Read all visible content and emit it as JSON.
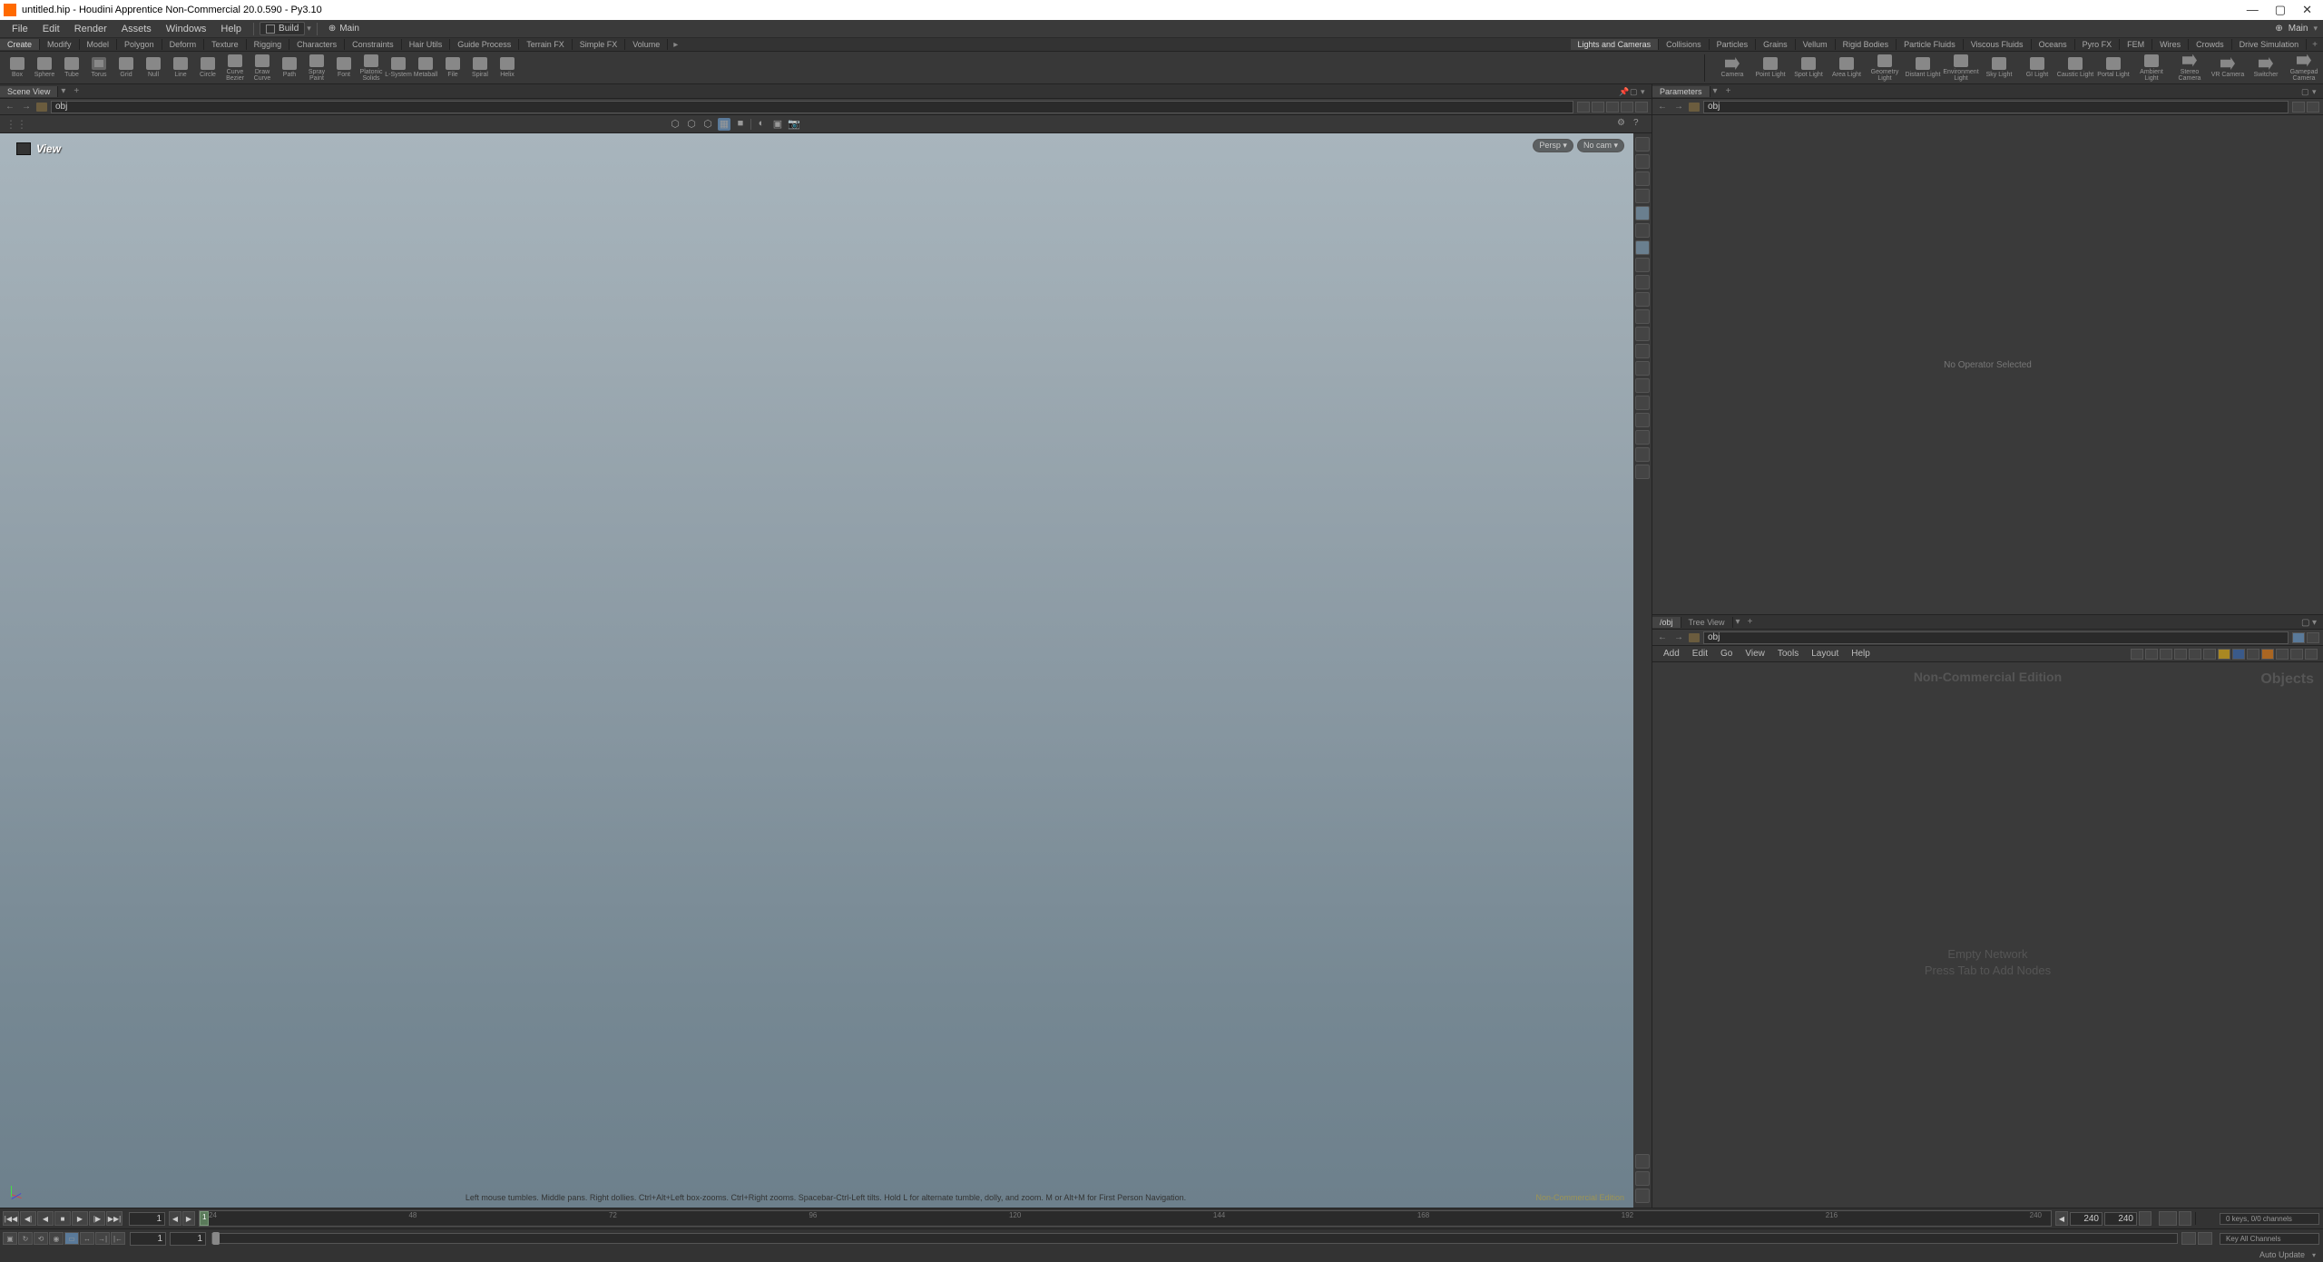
{
  "window": {
    "title": "untitled.hip - Houdini Apprentice Non-Commercial 20.0.590 - Py3.10"
  },
  "menubar": {
    "items": [
      "File",
      "Edit",
      "Render",
      "Assets",
      "Windows",
      "Help"
    ],
    "desktop": "Build",
    "radial": "Main",
    "radial_right": "Main"
  },
  "shelf_tabs_left": [
    "Create",
    "Modify",
    "Model",
    "Polygon",
    "Deform",
    "Texture",
    "Rigging",
    "Characters",
    "Constraints",
    "Hair Utils",
    "Guide Process",
    "Terrain FX",
    "Simple FX",
    "Volume"
  ],
  "shelf_tabs_right": [
    "Lights and Cameras",
    "Collisions",
    "Particles",
    "Grains",
    "Vellum",
    "Rigid Bodies",
    "Particle Fluids",
    "Viscous Fluids",
    "Oceans",
    "Pyro FX",
    "FEM",
    "Wires",
    "Crowds",
    "Drive Simulation"
  ],
  "shelf_left_tools": [
    {
      "label": "Box",
      "cls": "box"
    },
    {
      "label": "Sphere",
      "cls": "sphere"
    },
    {
      "label": "Tube",
      "cls": "tube"
    },
    {
      "label": "Torus",
      "cls": "torus"
    },
    {
      "label": "Grid",
      "cls": "grid"
    },
    {
      "label": "Null",
      "cls": "null"
    },
    {
      "label": "Line",
      "cls": "line"
    },
    {
      "label": "Circle",
      "cls": "circle"
    },
    {
      "label": "Curve Bezier",
      "cls": "purple"
    },
    {
      "label": "Draw Curve",
      "cls": "red"
    },
    {
      "label": "Path",
      "cls": "green"
    },
    {
      "label": "Spray Paint",
      "cls": "purple"
    },
    {
      "label": "Font",
      "cls": "box"
    },
    {
      "label": "Platonic Solids",
      "cls": "blue"
    },
    {
      "label": "L-System",
      "cls": "green"
    },
    {
      "label": "Metaball",
      "cls": "orange"
    },
    {
      "label": "File",
      "cls": "box"
    },
    {
      "label": "Spiral",
      "cls": "gold"
    },
    {
      "label": "Helix",
      "cls": "gold"
    }
  ],
  "shelf_right_tools": [
    {
      "label": "Camera",
      "cls": "cam"
    },
    {
      "label": "Point Light",
      "cls": "light"
    },
    {
      "label": "Spot Light",
      "cls": "light"
    },
    {
      "label": "Area Light",
      "cls": "light"
    },
    {
      "label": "Geometry Light",
      "cls": "light"
    },
    {
      "label": "Distant Light",
      "cls": "light"
    },
    {
      "label": "Environment Light",
      "cls": "light"
    },
    {
      "label": "Sky Light",
      "cls": "light"
    },
    {
      "label": "GI Light",
      "cls": "light"
    },
    {
      "label": "Caustic Light",
      "cls": "light"
    },
    {
      "label": "Portal Light",
      "cls": "light"
    },
    {
      "label": "Ambient Light",
      "cls": "light"
    },
    {
      "label": "Stereo Camera",
      "cls": "cam"
    },
    {
      "label": "VR Camera",
      "cls": "cam"
    },
    {
      "label": "Switcher",
      "cls": "cam"
    },
    {
      "label": "Gamepad Camera",
      "cls": "cam"
    }
  ],
  "panes": {
    "scene_view_tab": "Scene View",
    "parameters_tab": "Parameters",
    "network_tab_main": "/obj",
    "network_tab_tree": "Tree View"
  },
  "path": {
    "obj": "obj"
  },
  "viewport": {
    "label": "View",
    "persp": "Persp",
    "cam": "No cam",
    "help": "Left mouse tumbles. Middle pans. Right dollies. Ctrl+Alt+Left box-zooms. Ctrl+Right zooms. Spacebar-Ctrl-Left tilts. Hold L for alternate tumble, dolly, and zoom. M or Alt+M for First Person Navigation.",
    "watermark": "Non-Commercial Edition"
  },
  "parameters": {
    "empty_msg": "No Operator Selected"
  },
  "network": {
    "menus": [
      "Add",
      "Edit",
      "Go",
      "View",
      "Tools",
      "Layout",
      "Help"
    ],
    "edition": "Non-Commercial Edition",
    "title": "Objects",
    "empty1": "Empty Network",
    "empty2": "Press Tab to Add Nodes"
  },
  "timeline": {
    "current_frame": "1",
    "ticks": [
      "24",
      "48",
      "72",
      "96",
      "120",
      "144",
      "168",
      "192",
      "216",
      "240"
    ],
    "end_frame_a": "240",
    "end_frame_b": "240",
    "range_start": "1",
    "range_end": "1",
    "keys_status": "0 keys, 0/0 channels",
    "key_all": "Key All Channels"
  },
  "statusbar": {
    "auto_update": "Auto Update"
  }
}
